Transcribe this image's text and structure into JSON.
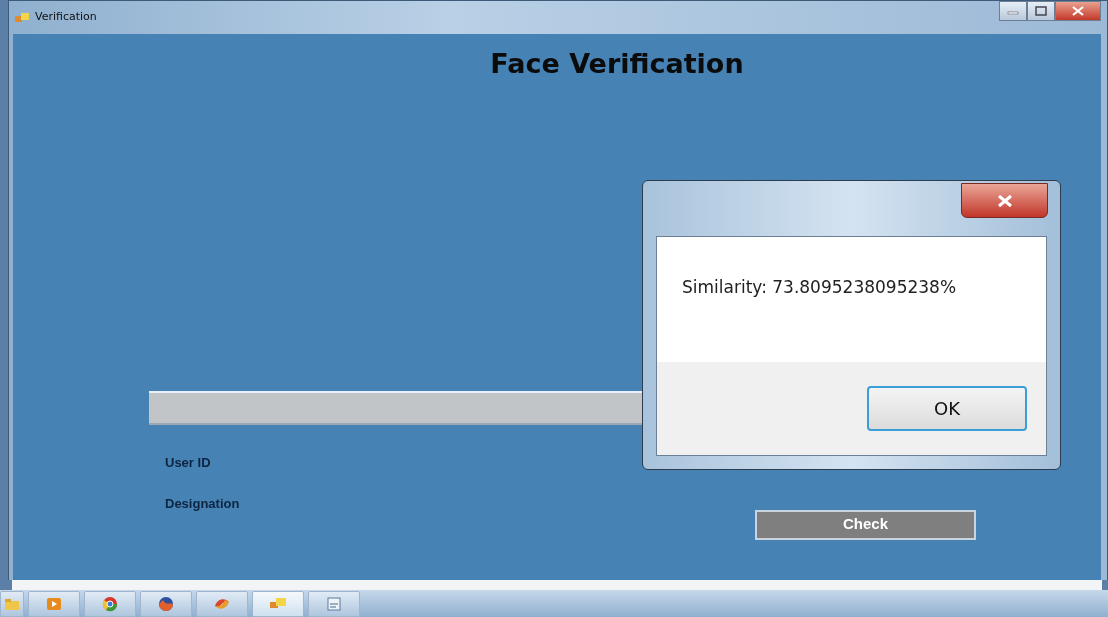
{
  "window": {
    "title": "Verification"
  },
  "heading": "Face Verification",
  "labels": [
    {
      "text": "User ID"
    },
    {
      "text": "Designation"
    }
  ],
  "check_button": "Check",
  "dialog": {
    "message": "Similarity: 73.8095238095238%",
    "buttons": [
      {
        "label": "OK",
        "selected": true
      }
    ]
  },
  "taskbar": {
    "items": [
      {
        "kind": "folder",
        "selected": false
      },
      {
        "kind": "media",
        "selected": false
      },
      {
        "kind": "ring",
        "selected": false
      },
      {
        "kind": "globe",
        "selected": false
      },
      {
        "kind": "swirl",
        "selected": false
      },
      {
        "kind": "app",
        "selected": true
      },
      {
        "kind": "document",
        "selected": false
      }
    ]
  }
}
